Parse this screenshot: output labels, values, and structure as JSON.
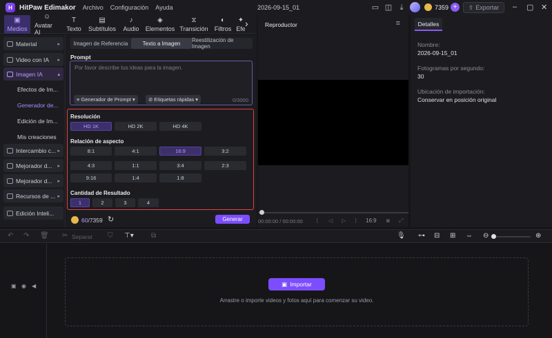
{
  "titlebar": {
    "app_name": "HitPaw Edimakor",
    "menus": [
      "Archivo",
      "Configuración",
      "Ayuda"
    ],
    "project_name": "2026-09-15_01",
    "credits": "7359",
    "export_label": "Exportar"
  },
  "media_tabs": [
    {
      "label": "Medios",
      "icon": "media-icon"
    },
    {
      "label": "Avatar AI",
      "icon": "avatar-icon"
    },
    {
      "label": "Texto",
      "icon": "text-icon"
    },
    {
      "label": "Subtítulos",
      "icon": "subtitles-icon"
    },
    {
      "label": "Audio",
      "icon": "music-icon"
    },
    {
      "label": "Elementos",
      "icon": "elements-icon"
    },
    {
      "label": "Transición",
      "icon": "transition-icon"
    },
    {
      "label": "Filtros",
      "icon": "filters-icon"
    },
    {
      "label": "Efe",
      "icon": "effects-icon"
    }
  ],
  "sidebar": {
    "items": [
      {
        "label": "Material"
      },
      {
        "label": "Video con IA"
      },
      {
        "label": "Imagen IA"
      },
      {
        "label": "Intercambio c..."
      },
      {
        "label": "Mejorador d..."
      },
      {
        "label": "Mejorador d..."
      },
      {
        "label": "Recursos de ..."
      },
      {
        "label": "Edición Inteli..."
      }
    ],
    "sub_items": [
      "Efectos de Im...",
      "Generador de...",
      "Edición de Im...",
      "Mis creaciones"
    ]
  },
  "panel": {
    "subtabs": [
      "Imagen de Referencia",
      "Texto a Imagen",
      "Reestilización de Imagen"
    ],
    "prompt_label": "Prompt",
    "prompt_placeholder": "Por favor describe tus ideas para la imagen.",
    "prompt_generator": "Generador de Prompt",
    "quick_tags": "Etiquetas rápidas",
    "char_count": "0",
    "char_max": "/3000",
    "resolution_label": "Resolución",
    "resolutions": [
      "HD 1K",
      "HD 2K",
      "HD 4K"
    ],
    "aspect_label": "Relación de aspecto",
    "aspects": [
      "8:1",
      "4:1",
      "16:9",
      "3:2",
      "4:3",
      "1:1",
      "3:4",
      "2:3",
      "9:16",
      "1:4",
      "1:8"
    ],
    "quantity_label": "Cantidad de Resultado",
    "quantities": [
      "1",
      "2",
      "3",
      "4"
    ],
    "cost_used": "60",
    "cost_total": "/7359",
    "generate_label": "Generar"
  },
  "player": {
    "title": "Reproductor",
    "current_time": "00:00:00",
    "total_time": "00:00:00",
    "ratio": "16:9"
  },
  "details": {
    "tab": "Detalles",
    "name_label": "Nombre:",
    "name_value": "2026-09-15_01",
    "fps_label": "Fotogramas por segundo:",
    "fps_value": "30",
    "import_label": "Ubicación de importación:",
    "import_value": "Conservar en posición original"
  },
  "timeline": {
    "split_label": "Separar",
    "import_label": "Importar",
    "drop_hint": "Arrastre o importe videos y fotos aquí para comenzar su video."
  },
  "colors": {
    "accent": "#7c4dff",
    "highlight_border": "#e3413f"
  }
}
